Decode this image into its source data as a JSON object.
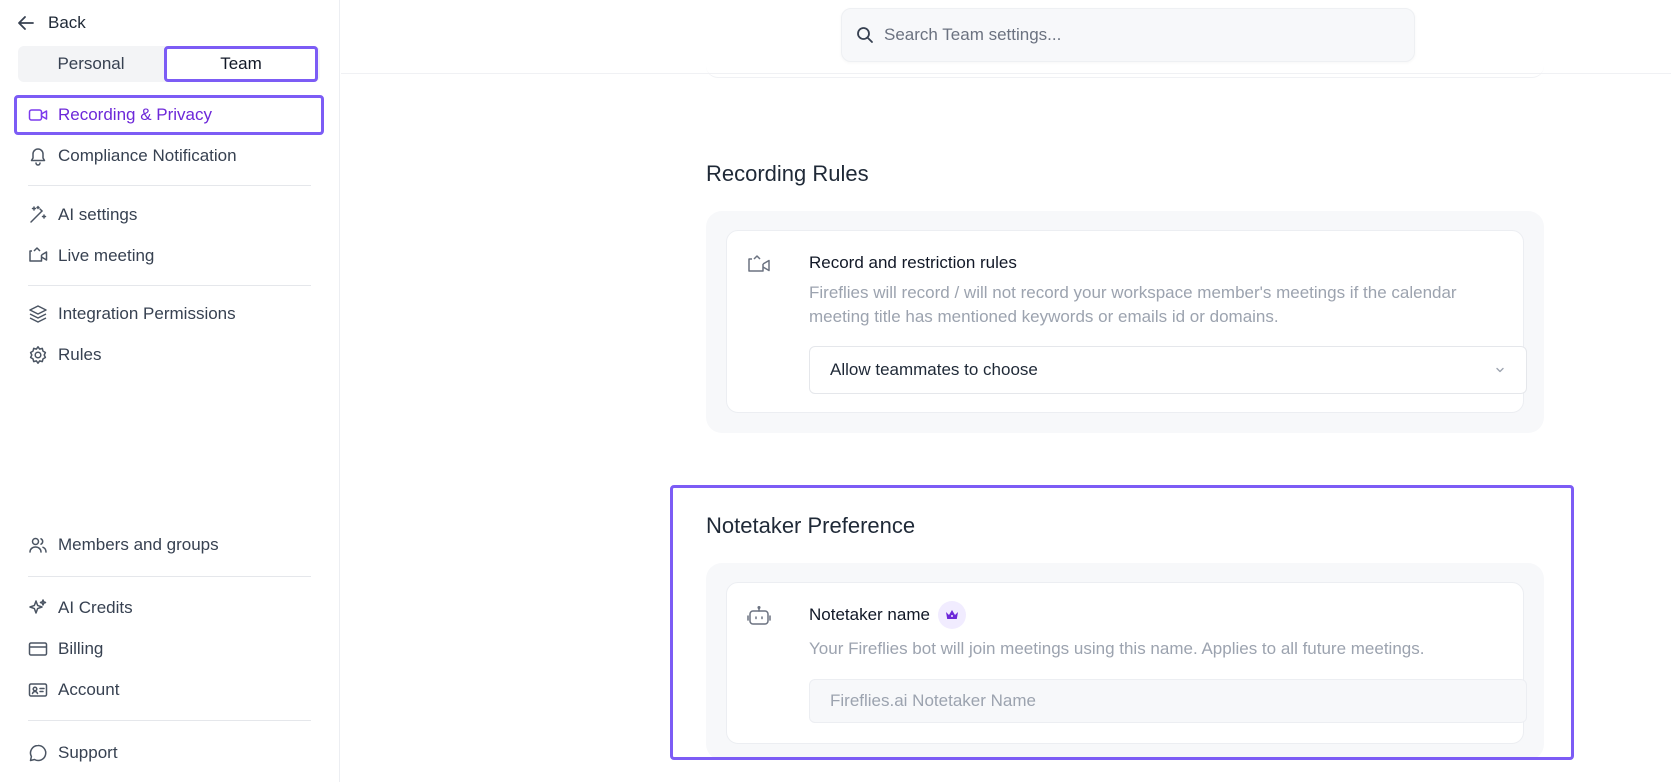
{
  "sidebar": {
    "back_label": "Back",
    "tabs": [
      {
        "label": "Personal",
        "active": false
      },
      {
        "label": "Team",
        "active": true
      }
    ],
    "items": [
      {
        "label": "Recording & Privacy",
        "icon": "video-camera-icon",
        "active": true
      },
      {
        "label": "Compliance Notification",
        "icon": "bell-icon"
      },
      {
        "label": "AI settings",
        "icon": "magic-wand-icon"
      },
      {
        "label": "Live meeting",
        "icon": "live-video-icon"
      },
      {
        "label": "Integration Permissions",
        "icon": "layers-icon"
      },
      {
        "label": "Rules",
        "icon": "gear-icon"
      },
      {
        "label": "Members and groups",
        "icon": "users-icon"
      },
      {
        "label": "AI Credits",
        "icon": "sparkle-icon"
      },
      {
        "label": "Billing",
        "icon": "credit-card-icon"
      },
      {
        "label": "Account",
        "icon": "id-card-icon"
      },
      {
        "label": "Support",
        "icon": "chat-bubble-icon"
      }
    ]
  },
  "search": {
    "placeholder": "Search Team settings..."
  },
  "recording_rules": {
    "section_title": "Recording Rules",
    "card_title": "Record and restriction rules",
    "card_description": "Fireflies will record / will not record your workspace member's meetings if the calendar meeting title has mentioned keywords or emails id or domains.",
    "select_value": "Allow teammates to choose"
  },
  "notetaker": {
    "section_title": "Notetaker Preference",
    "card_title": "Notetaker name",
    "card_description": "Your Fireflies bot will join meetings using this name. Applies to all future meetings.",
    "input_placeholder": "Fireflies.ai Notetaker Name",
    "input_value": ""
  },
  "colors": {
    "accent": "#7c5cf5",
    "active_text": "#6d28d9"
  }
}
